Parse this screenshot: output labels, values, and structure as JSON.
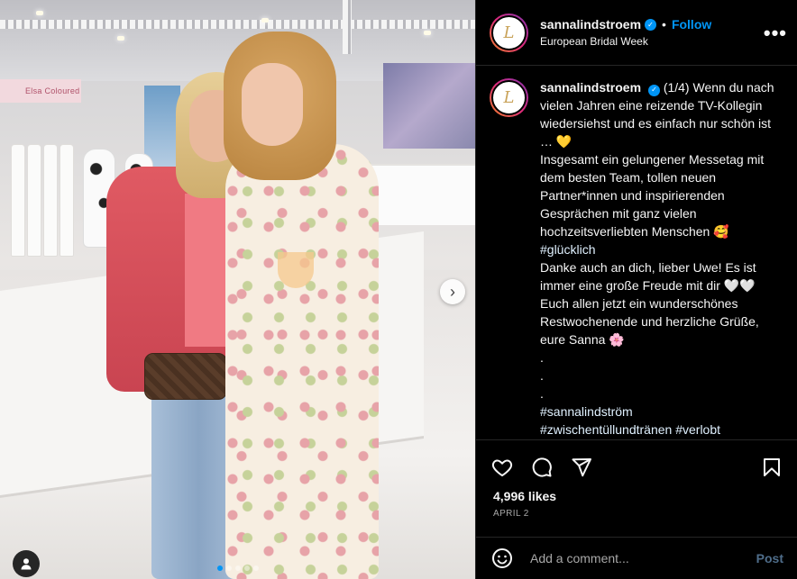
{
  "photo": {
    "booth_sign": "Elsa Coloured",
    "carousel_dots": 5,
    "active_dot": 0,
    "next_icon": "chevron-right-icon",
    "user_tag_icon": "person-icon"
  },
  "post": {
    "username": "sannalindstroem",
    "follow_label": "Follow",
    "bullet": "•",
    "location": "European Bridal Week",
    "more_label": "•••",
    "avatar_letter": "L"
  },
  "caption": {
    "username": "sannalindstroem",
    "lines": [
      "(1/4) Wenn du nach vielen Jahren eine reizende TV-Kollegin wiedersiehst und es einfach nur schön ist … 💛",
      "Insgesamt ein gelungener Messetag mit dem besten Team, tollen neuen Partner*innen und inspirierenden Gesprächen mit ganz vielen hochzeitsverliebten Menschen 🥰",
      "#glücklich",
      "Danke auch an dich, lieber Uwe! Es ist immer eine große Freude mit dir 🤍🤍",
      "Euch allen jetzt ein wunderschönes Restwochenende und herzliche Grüße, eure Sanna 🌸",
      ".",
      ".",
      "."
    ],
    "hashtags": [
      "#sannalindström",
      "#zwischentüllundtränen #verlobt"
    ]
  },
  "actions": {
    "like_icon": "heart-icon",
    "comment_icon": "comment-icon",
    "share_icon": "share-icon",
    "save_icon": "bookmark-icon",
    "likes": "4,996 likes",
    "date": "APRIL 2"
  },
  "comment": {
    "placeholder": "Add a comment...",
    "post_label": "Post"
  },
  "colors": {
    "accent": "#0095f6",
    "background": "#000000",
    "divider": "#262626",
    "muted": "#a8a8a8"
  }
}
